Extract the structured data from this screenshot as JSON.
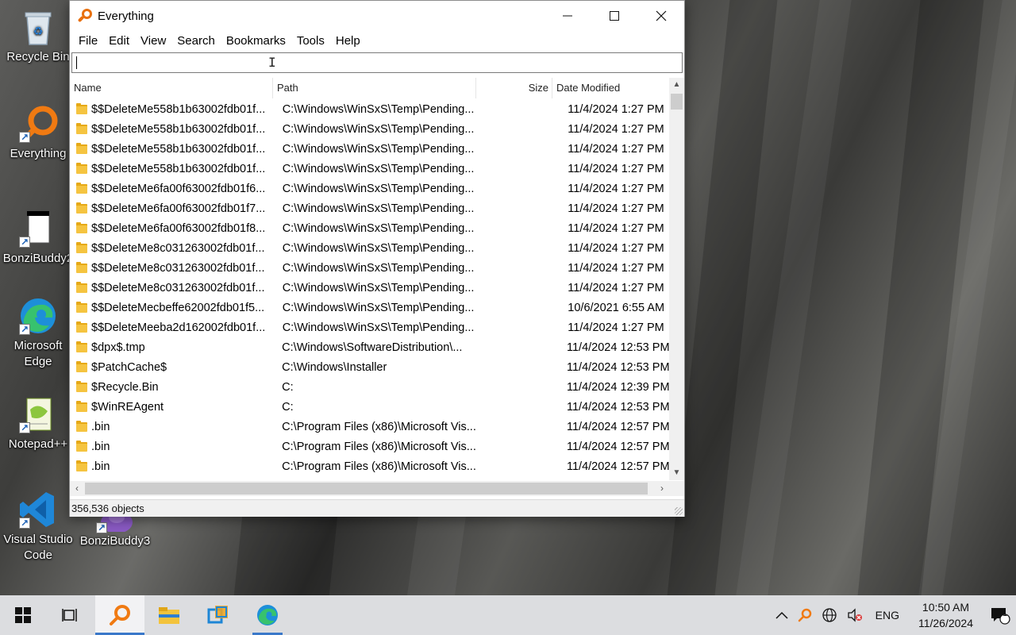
{
  "desktop": {
    "icons": [
      {
        "id": "recycle-bin",
        "label": "Recycle Bin"
      },
      {
        "id": "everything",
        "label": "Everything"
      },
      {
        "id": "bonzibuddy2",
        "label": "BonziBuddy2"
      },
      {
        "id": "edge",
        "label": "Microsoft Edge"
      },
      {
        "id": "notepadpp",
        "label": "Notepad++"
      },
      {
        "id": "vscode",
        "label": "Visual Studio Code"
      },
      {
        "id": "bonzibuddy3",
        "label": "BonziBuddy3"
      }
    ]
  },
  "window": {
    "title": "Everything",
    "menu": [
      "File",
      "Edit",
      "View",
      "Search",
      "Bookmarks",
      "Tools",
      "Help"
    ],
    "search": {
      "value": "",
      "placeholder": ""
    },
    "columns": {
      "name": "Name",
      "path": "Path",
      "size": "Size",
      "date": "Date Modified"
    },
    "rows": [
      {
        "name": "$$DeleteMe558b1b63002fdb01f...",
        "path": "C:\\Windows\\WinSxS\\Temp\\Pending...",
        "size": "",
        "date": "11/4/2024 1:27 PM"
      },
      {
        "name": "$$DeleteMe558b1b63002fdb01f...",
        "path": "C:\\Windows\\WinSxS\\Temp\\Pending...",
        "size": "",
        "date": "11/4/2024 1:27 PM"
      },
      {
        "name": "$$DeleteMe558b1b63002fdb01f...",
        "path": "C:\\Windows\\WinSxS\\Temp\\Pending...",
        "size": "",
        "date": "11/4/2024 1:27 PM"
      },
      {
        "name": "$$DeleteMe558b1b63002fdb01f...",
        "path": "C:\\Windows\\WinSxS\\Temp\\Pending...",
        "size": "",
        "date": "11/4/2024 1:27 PM"
      },
      {
        "name": "$$DeleteMe6fa00f63002fdb01f6...",
        "path": "C:\\Windows\\WinSxS\\Temp\\Pending...",
        "size": "",
        "date": "11/4/2024 1:27 PM"
      },
      {
        "name": "$$DeleteMe6fa00f63002fdb01f7...",
        "path": "C:\\Windows\\WinSxS\\Temp\\Pending...",
        "size": "",
        "date": "11/4/2024 1:27 PM"
      },
      {
        "name": "$$DeleteMe6fa00f63002fdb01f8...",
        "path": "C:\\Windows\\WinSxS\\Temp\\Pending...",
        "size": "",
        "date": "11/4/2024 1:27 PM"
      },
      {
        "name": "$$DeleteMe8c031263002fdb01f...",
        "path": "C:\\Windows\\WinSxS\\Temp\\Pending...",
        "size": "",
        "date": "11/4/2024 1:27 PM"
      },
      {
        "name": "$$DeleteMe8c031263002fdb01f...",
        "path": "C:\\Windows\\WinSxS\\Temp\\Pending...",
        "size": "",
        "date": "11/4/2024 1:27 PM"
      },
      {
        "name": "$$DeleteMe8c031263002fdb01f...",
        "path": "C:\\Windows\\WinSxS\\Temp\\Pending...",
        "size": "",
        "date": "11/4/2024 1:27 PM"
      },
      {
        "name": "$$DeleteMecbeffe62002fdb01f5...",
        "path": "C:\\Windows\\WinSxS\\Temp\\Pending...",
        "size": "",
        "date": "10/6/2021 6:55 AM"
      },
      {
        "name": "$$DeleteMeeba2d162002fdb01f...",
        "path": "C:\\Windows\\WinSxS\\Temp\\Pending...",
        "size": "",
        "date": "11/4/2024 1:27 PM"
      },
      {
        "name": "$dpx$.tmp",
        "path": "C:\\Windows\\SoftwareDistribution\\...",
        "size": "",
        "date": "11/4/2024 12:53 PM"
      },
      {
        "name": "$PatchCache$",
        "path": "C:\\Windows\\Installer",
        "size": "",
        "date": "11/4/2024 12:53 PM"
      },
      {
        "name": "$Recycle.Bin",
        "path": "C:",
        "size": "",
        "date": "11/4/2024 12:39 PM"
      },
      {
        "name": "$WinREAgent",
        "path": "C:",
        "size": "",
        "date": "11/4/2024 12:53 PM"
      },
      {
        "name": ".bin",
        "path": "C:\\Program Files (x86)\\Microsoft Vis...",
        "size": "",
        "date": "11/4/2024 12:57 PM"
      },
      {
        "name": ".bin",
        "path": "C:\\Program Files (x86)\\Microsoft Vis...",
        "size": "",
        "date": "11/4/2024 12:57 PM"
      },
      {
        "name": ".bin",
        "path": "C:\\Program Files (x86)\\Microsoft Vis...",
        "size": "",
        "date": "11/4/2024 12:57 PM"
      }
    ],
    "status": "356,536 objects"
  },
  "taskbar": {
    "language": "ENG",
    "time": "10:50 AM",
    "date": "11/26/2024",
    "notification_count": "1"
  },
  "colors": {
    "accent": "#3a78c9",
    "everything_orange": "#e8700f",
    "folder_yellow": "#f5c440"
  }
}
